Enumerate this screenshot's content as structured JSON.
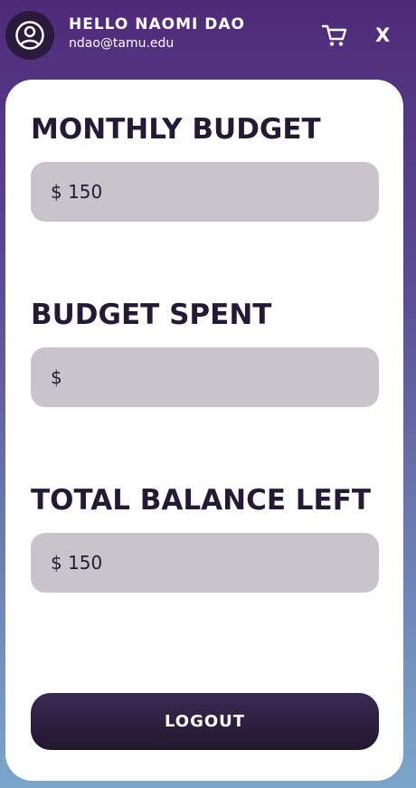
{
  "header": {
    "greeting": "HELLO NAOMI DAO",
    "email": "ndao@tamu.edu",
    "avatar_icon": "user-circle-icon",
    "cart_icon": "cart-icon",
    "close_label": "X"
  },
  "budget": {
    "monthly_label": "MONTHLY BUDGET",
    "monthly_value": "$ 150",
    "spent_label": "BUDGET SPENT",
    "spent_value": "$",
    "balance_label": "TOTAL BALANCE LEFT",
    "balance_value": "$ 150"
  },
  "actions": {
    "logout_label": "LOGOUT"
  },
  "colors": {
    "background_top": "#4f2a78",
    "background_bottom": "#7aa6cb",
    "field_bg": "#c9c4cb",
    "text_dark": "#251a35",
    "button_dark": "#22172f"
  }
}
